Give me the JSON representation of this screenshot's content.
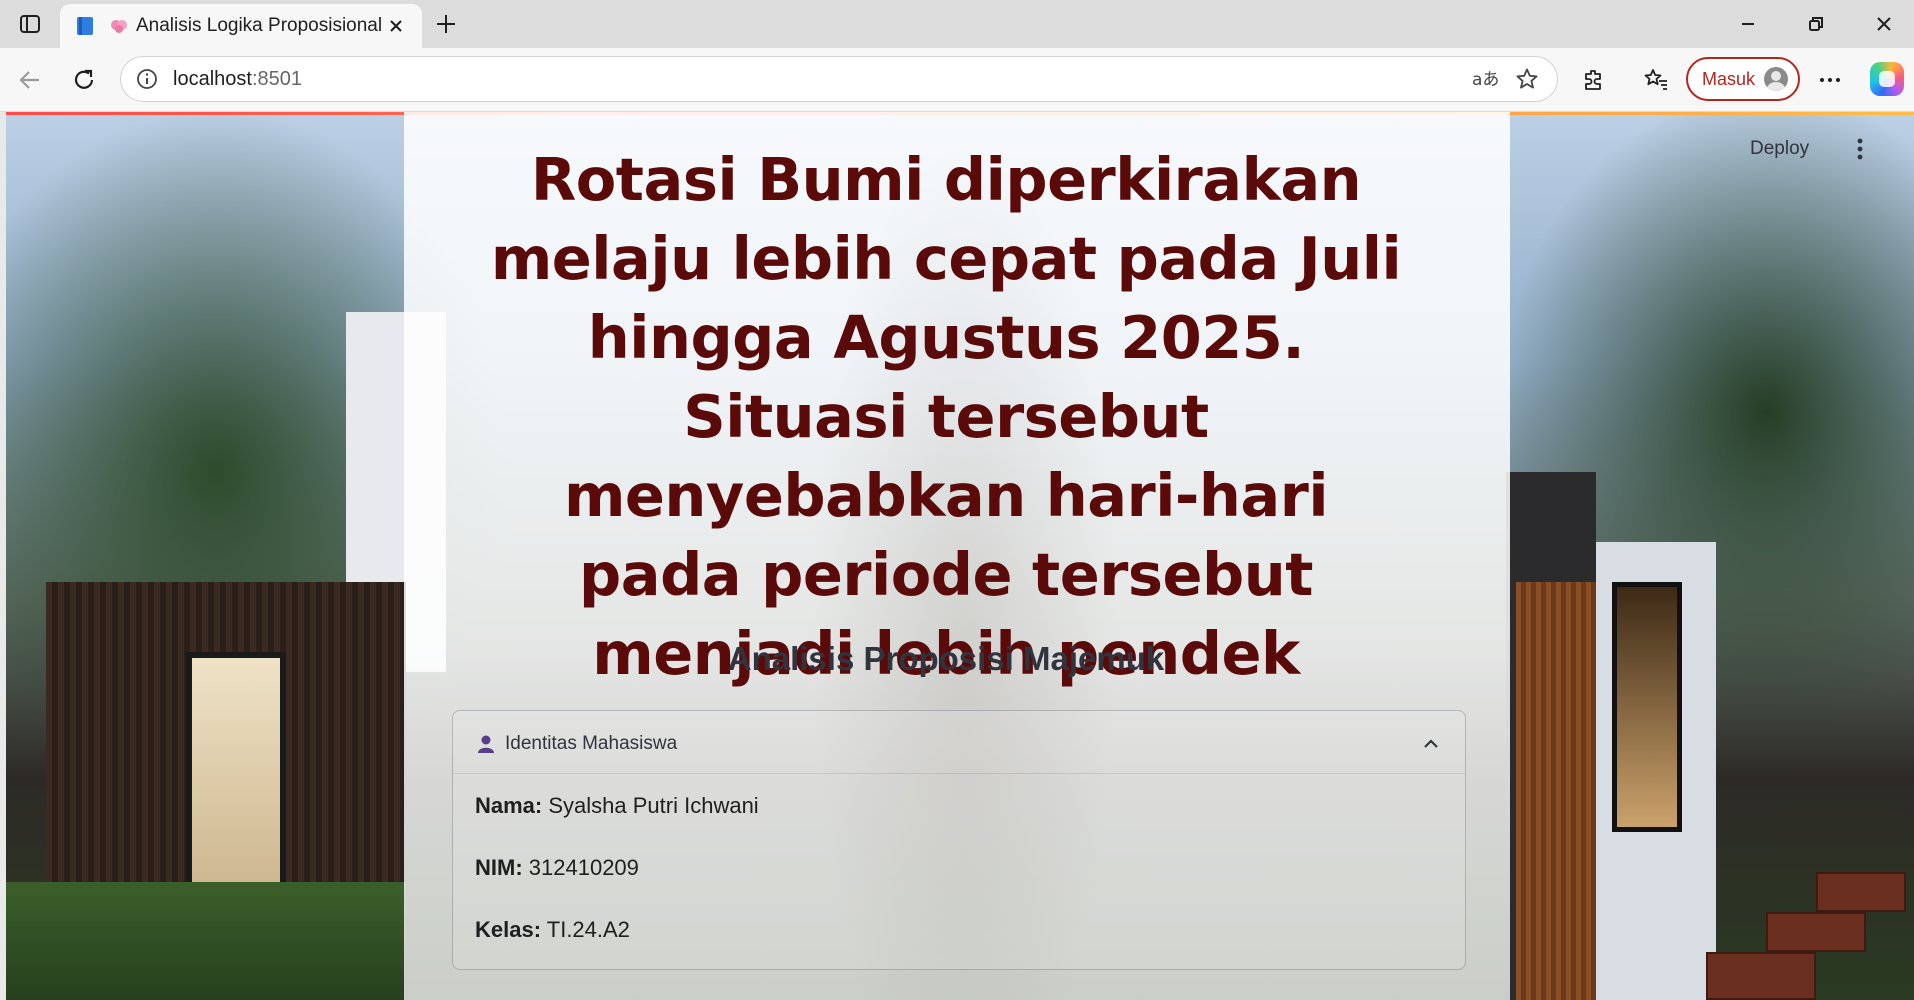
{
  "browser": {
    "tab_title": "Analisis Logika Proposisional",
    "url_host": "localhost",
    "url_port": ":8501",
    "signin_label": "Masuk"
  },
  "app": {
    "deploy_label": "Deploy",
    "headline": "Rotasi Bumi diperkirakan melaju lebih cepat pada Juli hingga Agustus 2025. Situasi tersebut menyebabkan hari-hari pada periode tersebut menjadi lebih pendek",
    "subheading": "Analisis Proposisi Majemuk",
    "expander": {
      "label": "Identitas Mahasiswa",
      "fields": [
        {
          "key": "Nama:",
          "value": "Syalsha Putri Ichwani"
        },
        {
          "key": "NIM:",
          "value": "312410209"
        },
        {
          "key": "Kelas:",
          "value": "TI.24.A2"
        }
      ]
    }
  },
  "colors": {
    "headline": "#5b0a0a",
    "signin_border": "#b3261e",
    "text": "#31333f"
  }
}
